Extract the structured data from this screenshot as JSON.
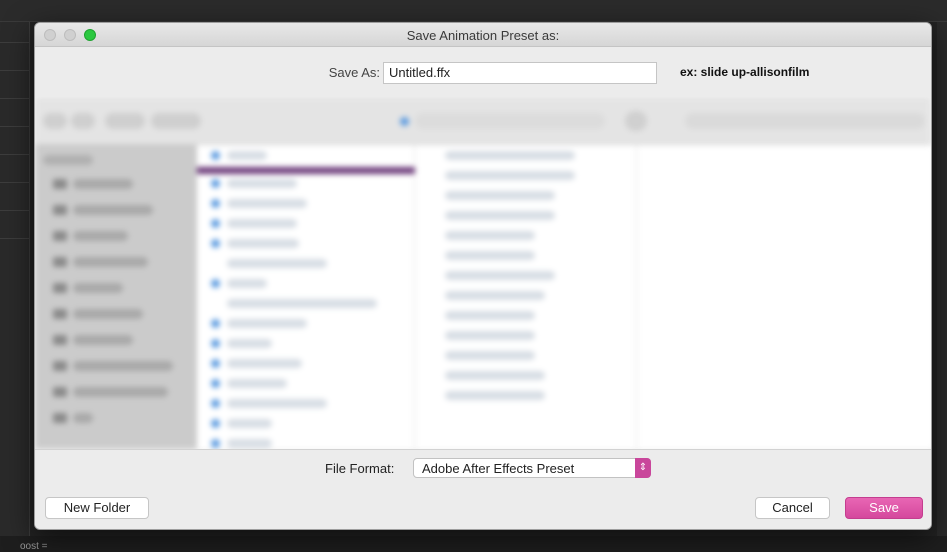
{
  "background": {
    "bottom_text": "oost ="
  },
  "dialog": {
    "title": "Save Animation Preset as:",
    "save_as_label": "Save As:",
    "save_as_value": "Untitled.ffx",
    "hint": "ex: slide up-allisonfilm",
    "file_format_label": "File Format:",
    "file_format_value": "Adobe After Effects Preset",
    "buttons": {
      "new_folder": "New Folder",
      "cancel": "Cancel",
      "save": "Save"
    }
  },
  "colors": {
    "accent": "#d5489d",
    "selection": "#6c3a7a",
    "zoom_button": "#2bc840"
  },
  "icons": {
    "select_arrow": "chevron-up-down-icon"
  }
}
